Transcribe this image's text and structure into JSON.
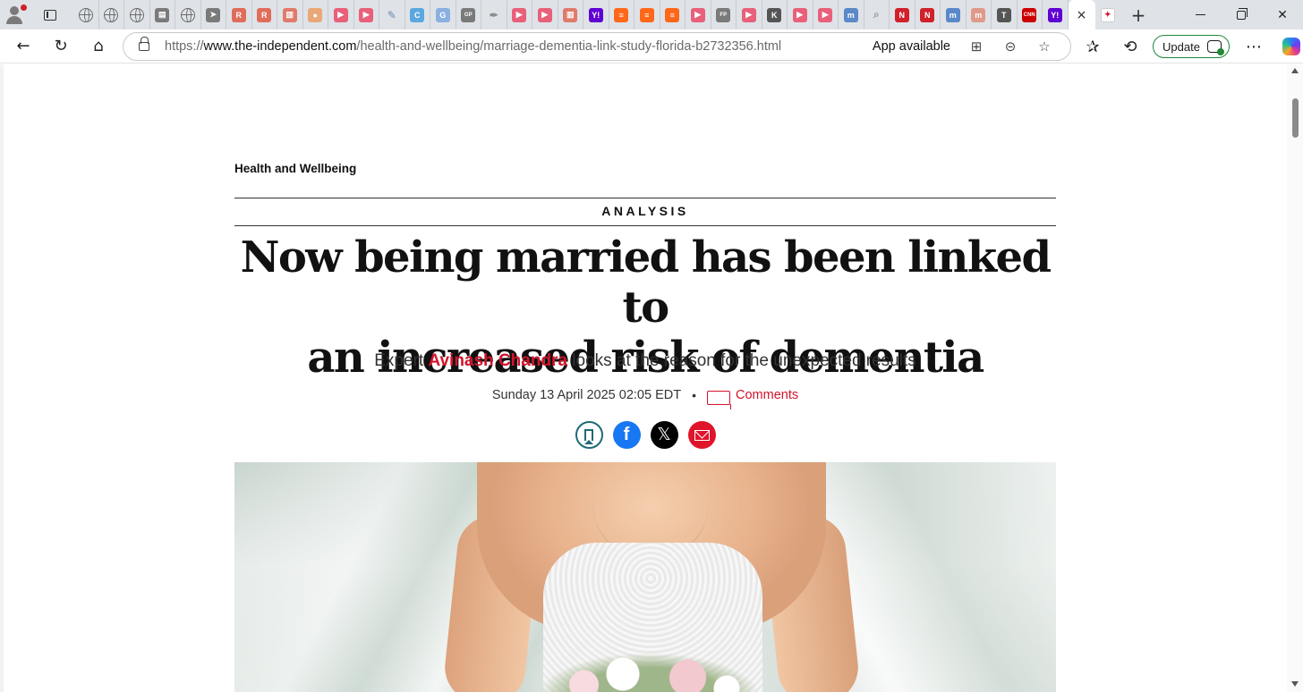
{
  "browser": {
    "tabs": [
      {
        "icon": "globe-icon",
        "color": ""
      },
      {
        "icon": "globe-icon",
        "color": ""
      },
      {
        "icon": "globe-icon",
        "color": ""
      },
      {
        "icon": "news-icon",
        "color": "#7a7a7a"
      },
      {
        "icon": "globe-icon",
        "color": ""
      },
      {
        "icon": "arrow-icon",
        "color": "#7a7a7a"
      },
      {
        "icon": "r-icon",
        "color": "#e06c5a"
      },
      {
        "icon": "r-icon",
        "color": "#e06c5a"
      },
      {
        "icon": "pdf-icon",
        "color": "#e07a6a"
      },
      {
        "icon": "circle-icon",
        "color": "#e8a878"
      },
      {
        "icon": "youtube-icon",
        "color": "#e8607a"
      },
      {
        "icon": "youtube-icon",
        "color": "#e8607a"
      },
      {
        "icon": "pin-icon",
        "color": "#9ab0c8"
      },
      {
        "icon": "c-icon",
        "color": "#5aa8e0"
      },
      {
        "icon": "g-icon",
        "color": "#8ab0e0"
      },
      {
        "icon": "gp-icon",
        "color": "#7a7a7a"
      },
      {
        "icon": "feather-icon",
        "color": "#8a8a8a"
      },
      {
        "icon": "youtube-icon",
        "color": "#e8607a"
      },
      {
        "icon": "youtube-icon",
        "color": "#e8607a"
      },
      {
        "icon": "pdf-icon",
        "color": "#e07a6a"
      },
      {
        "icon": "yahoo-icon",
        "color": "#6001d2"
      },
      {
        "icon": "substack-icon",
        "color": "#ff6719"
      },
      {
        "icon": "substack-icon",
        "color": "#ff6719"
      },
      {
        "icon": "substack-icon",
        "color": "#ff6719"
      },
      {
        "icon": "youtube-icon",
        "color": "#e8607a"
      },
      {
        "icon": "fp-icon",
        "color": "#7a7a7a"
      },
      {
        "icon": "youtube-icon",
        "color": "#e8607a"
      },
      {
        "icon": "k-icon",
        "color": "#555555"
      },
      {
        "icon": "youtube-icon",
        "color": "#e8607a"
      },
      {
        "icon": "youtube-icon",
        "color": "#e8607a"
      },
      {
        "icon": "m-icon",
        "color": "#5a88c8"
      },
      {
        "icon": "search-icon",
        "color": "#9a9a9a"
      },
      {
        "icon": "n-icon",
        "color": "#d0202a"
      },
      {
        "icon": "n-icon",
        "color": "#d0202a"
      },
      {
        "icon": "m-icon",
        "color": "#5a88c8"
      },
      {
        "icon": "m-icon",
        "color": "#e09a8a"
      },
      {
        "icon": "t-icon",
        "color": "#555555"
      },
      {
        "icon": "cnn-icon",
        "color": "#cc0000"
      },
      {
        "icon": "yahoo-icon",
        "color": "#6001d2"
      }
    ],
    "active_tab": {
      "icon": "independent-eagle-icon",
      "close": "×"
    },
    "inactive_after_active": {
      "icon": "independent-eagle-icon"
    },
    "new_tab": "+",
    "url_scheme": "https://",
    "url_host": "www.the-independent.com",
    "url_path": "/health-and-wellbeing/marriage-dementia-link-study-florida-b2732356.html",
    "app_available": "App available",
    "update_label": "Update",
    "accent_green": "#1f8a3a"
  },
  "article": {
    "section": "Health and Wellbeing",
    "kicker": "ANALYSIS",
    "headline_line1": "Now being married has been linked to",
    "headline_line2": "an increased risk of dementia",
    "standfirst_prefix": "Expert ",
    "author": "Avinash Chandra",
    "standfirst_suffix": " looks at the reason for the unexpected results",
    "date": "Sunday 13 April 2025 02:05 EDT",
    "separator": "•",
    "comments_label": "Comments",
    "share": {
      "bookmark_icon": "bookmark-icon",
      "facebook_glyph": "f",
      "x_glyph": "𝕏",
      "email_icon": "email-icon"
    },
    "brand_red": "#d2142b"
  }
}
